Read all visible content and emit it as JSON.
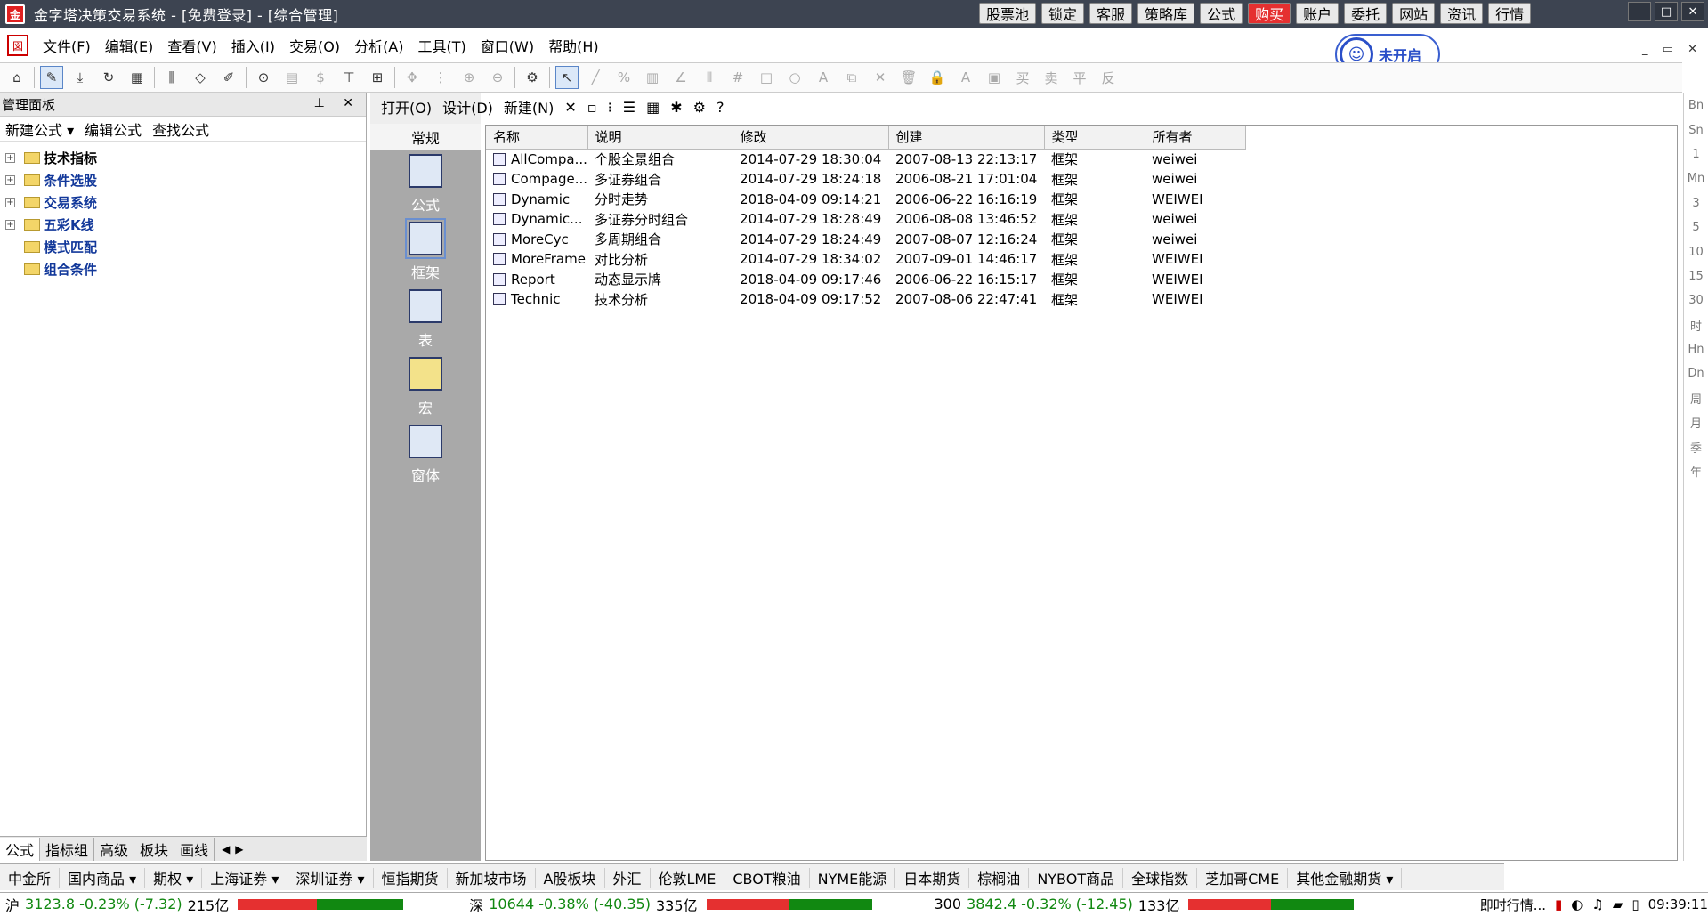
{
  "window": {
    "title": "金字塔决策交易系统 - [免费登录] - [综合管理]",
    "app_icon": "app-logo-icon"
  },
  "top_buttons": [
    "股票池",
    "锁定",
    "客服",
    "策略库",
    "公式",
    "购买",
    "账户",
    "委托",
    "网站",
    "资讯",
    "行情"
  ],
  "menu": [
    "文件(F)",
    "编辑(E)",
    "查看(V)",
    "插入(I)",
    "交易(O)",
    "分析(A)",
    "工具(T)",
    "窗口(W)",
    "帮助(H)"
  ],
  "user_badge": {
    "label": "未开启"
  },
  "left_panel": {
    "title": "管理面板",
    "tools": [
      "新建公式 ▾",
      "编辑公式",
      "查找公式"
    ],
    "tree": [
      {
        "label": "技术指标",
        "expandable": true
      },
      {
        "label": "条件选股",
        "expandable": true
      },
      {
        "label": "交易系统",
        "expandable": true
      },
      {
        "label": "五彩K线",
        "expandable": true
      },
      {
        "label": "模式匹配",
        "expandable": false
      },
      {
        "label": "组合条件",
        "expandable": false
      }
    ],
    "tabs": [
      "公式",
      "指标组",
      "高级",
      "板块",
      "画线"
    ]
  },
  "formula_toolbar": [
    "打开(O)",
    "设计(D)",
    "新建(N)"
  ],
  "categories": {
    "header": "常规",
    "items": [
      "公式",
      "框架",
      "表",
      "宏",
      "窗体"
    ],
    "selected": "框架"
  },
  "table": {
    "columns": [
      "名称",
      "说明",
      "修改",
      "创建",
      "类型",
      "所有者"
    ],
    "rows": [
      [
        "AllCompa...",
        "个股全景组合",
        "2014-07-29 18:30:04",
        "2007-08-13 22:13:17",
        "框架",
        "weiwei"
      ],
      [
        "Compage...",
        "多证券组合",
        "2014-07-29 18:24:18",
        "2006-08-21 17:01:04",
        "框架",
        "weiwei"
      ],
      [
        "Dynamic",
        "分时走势",
        "2018-04-09 09:14:21",
        "2006-06-22 16:16:19",
        "框架",
        "WEIWEI"
      ],
      [
        "Dynamic...",
        "多证券分时组合",
        "2014-07-29 18:28:49",
        "2006-08-08 13:46:52",
        "框架",
        "weiwei"
      ],
      [
        "MoreCyc",
        "多周期组合",
        "2014-07-29 18:24:49",
        "2007-08-07 12:16:24",
        "框架",
        "weiwei"
      ],
      [
        "MoreFrame",
        "对比分析",
        "2014-07-29 18:34:02",
        "2007-09-01 14:46:17",
        "框架",
        "WEIWEI"
      ],
      [
        "Report",
        "动态显示牌",
        "2018-04-09 09:17:46",
        "2006-06-22 16:15:17",
        "框架",
        "WEIWEI"
      ],
      [
        "Technic",
        "技术分析",
        "2018-04-09 09:17:52",
        "2007-08-06 22:47:41",
        "框架",
        "WEIWEI"
      ]
    ]
  },
  "right_strip": [
    "Bn",
    "Sn",
    "1",
    "Mn",
    "3",
    "5",
    "10",
    "15",
    "30",
    "时",
    "Hn",
    "Dn",
    "周",
    "月",
    "季",
    "年"
  ],
  "market_tabs": [
    "中金所",
    "国内商品 ▾",
    "期权 ▾",
    "上海证券 ▾",
    "深圳证券 ▾",
    "恒指期货",
    "新加坡市场",
    "A股板块",
    "外汇",
    "伦敦LME",
    "CBOT粮油",
    "NYME能源",
    "日本期货",
    "棕榈油",
    "NYBOT商品",
    "全球指数",
    "芝加哥CME",
    "其他金融期货 ▾"
  ],
  "status": {
    "sh": {
      "label": "沪",
      "value": "3123.8 -0.23% (-7.32)",
      "amount": "215亿"
    },
    "sz": {
      "label": "深",
      "value": "10644 -0.38% (-40.35)",
      "amount": "335亿"
    },
    "hs300": {
      "label": "300",
      "value": "3842.4 -0.32% (-12.45)",
      "amount": "133亿"
    },
    "realtime": "即时行情...",
    "clock": "09:39:11"
  },
  "colors": {
    "titlebar": "#3d4451",
    "link_blue": "#12389a",
    "up": "#e53030",
    "down": "#118811",
    "category_bg": "#a9a9a9"
  }
}
